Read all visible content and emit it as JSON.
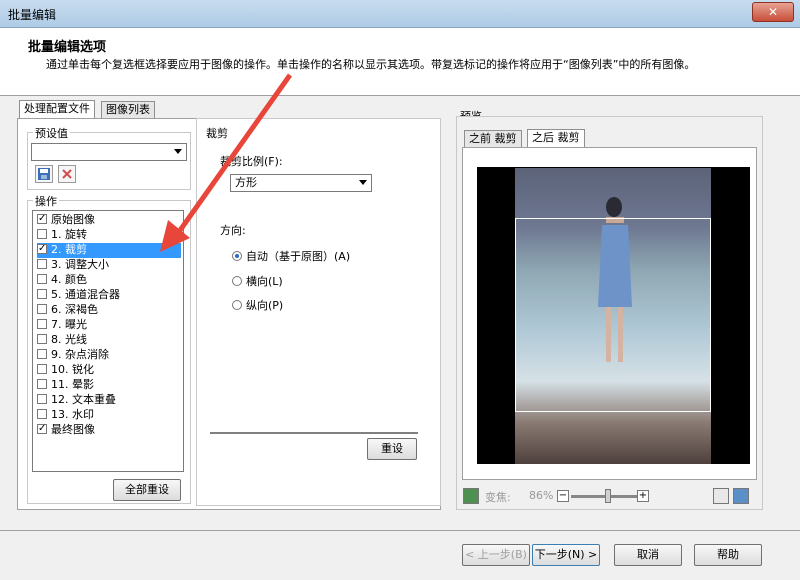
{
  "window": {
    "title": "批量编辑",
    "close_label": "✕"
  },
  "header": {
    "title": "批量编辑选项",
    "description": "通过单击每个复选框选择要应用于图像的操作。单击操作的名称以显示其选项。带复选标记的操作将应用于“图像列表”中的所有图像。"
  },
  "left_tabs": [
    {
      "label": "处理配置文件",
      "active": true
    },
    {
      "label": "图像列表",
      "active": false
    }
  ],
  "presets": {
    "label": "预设值",
    "value": ""
  },
  "operations": {
    "label": "操作",
    "items": [
      {
        "label": "原始图像",
        "checked": true,
        "selected": false
      },
      {
        "label": "1.  旋转",
        "checked": false,
        "selected": false
      },
      {
        "label": "2.  裁剪",
        "checked": true,
        "selected": true
      },
      {
        "label": "3.  调整大小",
        "checked": false,
        "selected": false
      },
      {
        "label": "4.  颜色",
        "checked": false,
        "selected": false
      },
      {
        "label": "5.  通道混合器",
        "checked": false,
        "selected": false
      },
      {
        "label": "6.  深褐色",
        "checked": false,
        "selected": false
      },
      {
        "label": "7.  曝光",
        "checked": false,
        "selected": false
      },
      {
        "label": "8.  光线",
        "checked": false,
        "selected": false
      },
      {
        "label": "9.  杂点消除",
        "checked": false,
        "selected": false
      },
      {
        "label": "10.  锐化",
        "checked": false,
        "selected": false
      },
      {
        "label": "11.  晕影",
        "checked": false,
        "selected": false
      },
      {
        "label": "12.  文本重叠",
        "checked": false,
        "selected": false
      },
      {
        "label": "13.  水印",
        "checked": false,
        "selected": false
      },
      {
        "label": "最终图像",
        "checked": true,
        "selected": false
      }
    ],
    "reset_all_label": "全部重设"
  },
  "crop": {
    "section_label": "裁剪",
    "ratio_label": "裁剪比例(F):",
    "ratio_value": "方形",
    "direction_label": "方向:",
    "options": [
      {
        "label": "自动（基于原图）(A)",
        "on": true
      },
      {
        "label": "横向(L)",
        "on": false
      },
      {
        "label": "纵向(P)",
        "on": false
      }
    ],
    "reset_label": "重设"
  },
  "preview": {
    "label": "预览",
    "tabs": [
      {
        "label": "之前 裁剪",
        "active": false
      },
      {
        "label": "之后 裁剪",
        "active": true
      }
    ],
    "zoom_label": "变焦:",
    "zoom_value": "86%"
  },
  "footer": {
    "prev_label": "< 上一步(B)",
    "next_label": "下一步(N) >",
    "cancel_label": "取消",
    "help_label": "帮助"
  },
  "colors": {
    "selection": "#3399ff",
    "arrow": "#e8463a"
  }
}
